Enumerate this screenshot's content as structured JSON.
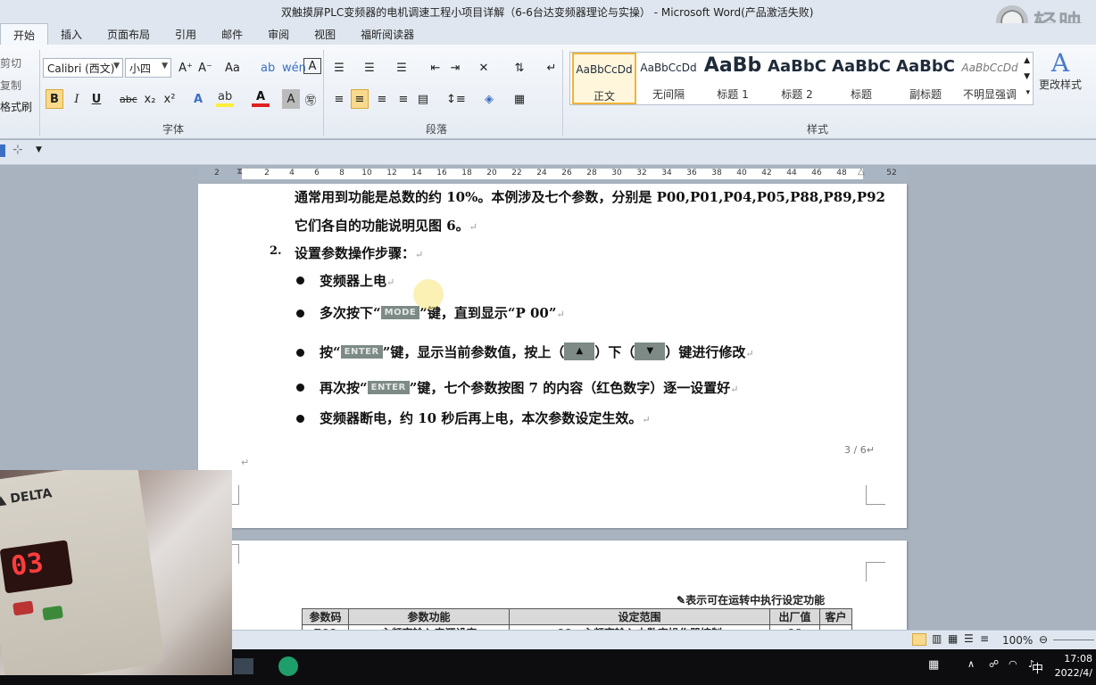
{
  "window": {
    "title": "双触摸屏PLC变频器的电机调速工程小项目详解（6-6台达变频器理论与实操） - Microsoft Word(产品激活失败)",
    "watermark": "轻映"
  },
  "tabs": [
    "开始",
    "插入",
    "页面布局",
    "引用",
    "邮件",
    "审阅",
    "视图",
    "福昕阅读器"
  ],
  "ribbon": {
    "clipboard": {
      "cut": "剪切",
      "copy": "复制",
      "format_painter": "格式刷"
    },
    "font": {
      "name": "Calibri (西文)",
      "size": "小四",
      "group_label": "字体",
      "bold": "B",
      "italic": "I",
      "underline": "U",
      "strike": "abc",
      "sub": "x₂",
      "sup": "x²",
      "grow": "A⁺",
      "shrink": "A⁻",
      "case": "Aa",
      "clear": "A",
      "char_border": "A"
    },
    "paragraph": {
      "group_label": "段落"
    },
    "styles": {
      "group_label": "样式",
      "items": [
        {
          "sample": "AaBbCcDd",
          "name": "正文"
        },
        {
          "sample": "AaBbCcDd",
          "name": "无间隔"
        },
        {
          "sample": "AaBb",
          "name": "标题 1"
        },
        {
          "sample": "AaBbC",
          "name": "标题 2"
        },
        {
          "sample": "AaBbC",
          "name": "标题"
        },
        {
          "sample": "AaBbC",
          "name": "副标题"
        },
        {
          "sample": "AaBbCcDd",
          "name": "不明显强调"
        }
      ],
      "change_styles": "更改样式"
    }
  },
  "ruler": {
    "ticks": [
      "2",
      "2",
      "4",
      "6",
      "8",
      "10",
      "12",
      "14",
      "16",
      "18",
      "20",
      "22",
      "24",
      "26",
      "28",
      "30",
      "32",
      "34",
      "36",
      "38",
      "40",
      "42",
      "44",
      "46",
      "48",
      "52"
    ]
  },
  "document": {
    "line1": "通常用到功能是总数的约 10%。本例涉及七个参数，分别是 P00,P01,P04,P05,P88,P89,P92",
    "line2": "它们各自的功能说明见图 6。",
    "step_number": "2.",
    "step_title": "设置参数操作步骤：",
    "bullets": {
      "b1": "变频器上电",
      "b2_pre": "多次按下“",
      "b2_key": "MODE",
      "b2_post": "”键，直到显示“P  00”",
      "b3_pre": "按“",
      "b3_key": "ENTER",
      "b3_mid": "”键，显示当前参数值，按上（",
      "b3_up": "▲",
      "b3_mid2": "）下（",
      "b3_down": "▼",
      "b3_post": "）键进行修改",
      "b4_pre": "再次按“",
      "b4_key": "ENTER",
      "b4_post": "”键，七个参数按图 7 的内容（红色数字）逐一设置好",
      "b5": "变频器断电，约 10 秒后再上电，本次参数设定生效。"
    },
    "page_number": "3 / 6",
    "page2_note": "表示可在运转中执行设定功能",
    "table_headers": [
      "参数码",
      "参数功能",
      "设定范围",
      "出厂值",
      "客户"
    ],
    "table_row": [
      "P00",
      "主频率输入来源设定",
      "00：主频率输入由数字操作器控制",
      "00",
      ""
    ]
  },
  "statusbar": {
    "zoom": "100%"
  },
  "taskbar": {
    "time": "17:08",
    "date": "2022/4/",
    "ime": "中"
  },
  "webcam": {
    "brand": "DELTA",
    "display": "03"
  }
}
